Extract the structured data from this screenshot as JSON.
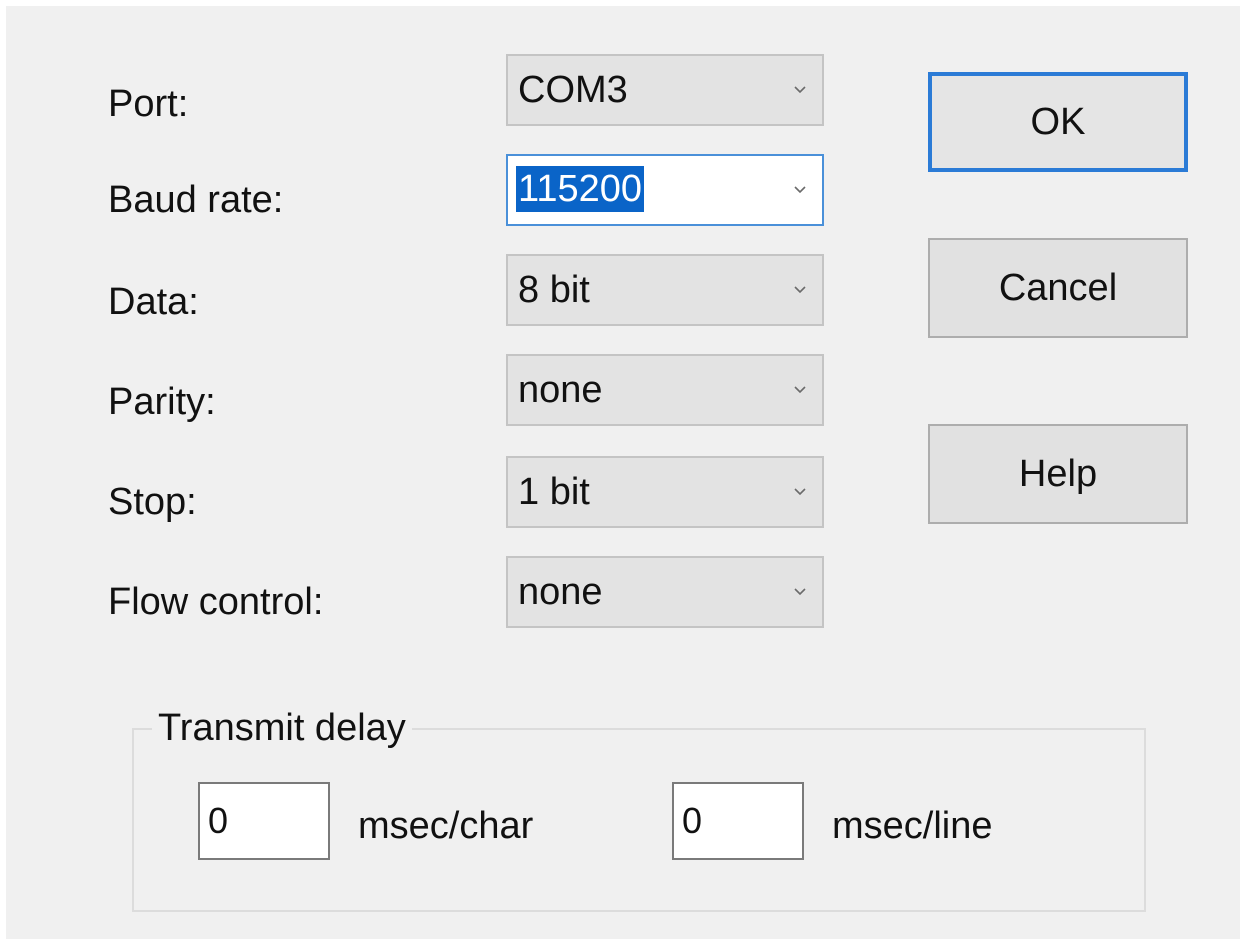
{
  "fields": [
    {
      "label": "Port:",
      "value": "COM3"
    },
    {
      "label": "Baud rate:",
      "value": "115200"
    },
    {
      "label": "Data:",
      "value": "8 bit"
    },
    {
      "label": "Parity:",
      "value": "none"
    },
    {
      "label": "Stop:",
      "value": "1 bit"
    },
    {
      "label": "Flow control:",
      "value": "none"
    }
  ],
  "buttons": {
    "ok": "OK",
    "cancel": "Cancel",
    "help": "Help"
  },
  "transmit_delay": {
    "title": "Transmit delay",
    "char_value": "0",
    "char_unit": "msec/char",
    "line_value": "0",
    "line_unit": "msec/line"
  },
  "icons": {
    "dropdown": "chevron-down-icon"
  },
  "colors": {
    "dialog_bg": "#f0f0f0",
    "focus_border": "#4a90d9",
    "selection_bg": "#0a64c8",
    "default_button_border": "#2b7bd6"
  }
}
